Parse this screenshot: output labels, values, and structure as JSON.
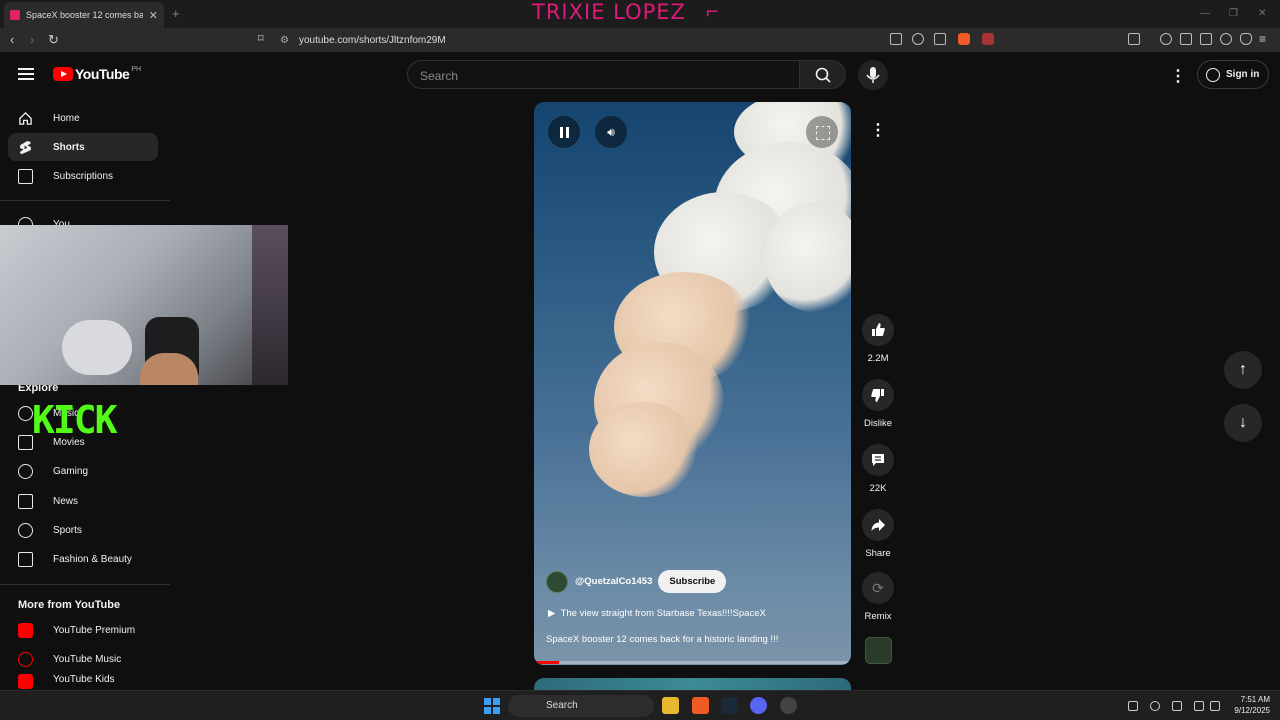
{
  "browser": {
    "tab_title": "SpaceX booster 12 comes ba",
    "tab_close": "✕",
    "new_tab": "+",
    "url": "youtube.com/shorts/Jltznfom29M",
    "overlay_name": "TRIXIE LOPEZ",
    "overlay_bracket": "⌐"
  },
  "youtube": {
    "logo_text": "YouTube",
    "country_code": "PH",
    "search_placeholder": "Search",
    "sign_in": "Sign in",
    "menu_dots": "⋮"
  },
  "sidebar": {
    "items": [
      {
        "label": "Home",
        "icon": "home-icon"
      },
      {
        "label": "Shorts",
        "icon": "shorts-icon"
      },
      {
        "label": "Subscriptions",
        "icon": "subscriptions-icon"
      }
    ],
    "you_label": "You",
    "explore_heading": "Explore",
    "explore_items": [
      {
        "label": "Music",
        "icon": "music-icon"
      },
      {
        "label": "Movies",
        "icon": "movies-icon"
      },
      {
        "label": "Gaming",
        "icon": "gaming-icon"
      },
      {
        "label": "News",
        "icon": "news-icon"
      },
      {
        "label": "Sports",
        "icon": "sports-icon"
      },
      {
        "label": "Fashion & Beauty",
        "icon": "fashion-icon"
      }
    ],
    "more_heading": "More from YouTube",
    "more_items": [
      {
        "label": "YouTube Premium",
        "icon": "youtube-premium-icon"
      },
      {
        "label": "YouTube Music",
        "icon": "youtube-music-icon"
      },
      {
        "label": "YouTube Kids",
        "icon": "youtube-kids-icon"
      }
    ]
  },
  "stream_overlay": {
    "kick_text": "KICK"
  },
  "short": {
    "channel": "@QuetzalCo1453",
    "subscribe": "Subscribe",
    "link_text": "The view straight from Starbase Texas!!!!SpaceX",
    "title": "SpaceX booster 12 comes back for a historic landing !!!",
    "progress": 0.08
  },
  "actions": {
    "likes": "2.2M",
    "dislike": "Dislike",
    "comments": "22K",
    "share": "Share",
    "remix": "Remix"
  },
  "taskbar": {
    "search": "Search",
    "time": "7:51 AM",
    "date": "9/12/2025"
  },
  "colors": {
    "accent": "#ff0000",
    "kick": "#53fc18",
    "overlay_name": "#e01a7a"
  }
}
